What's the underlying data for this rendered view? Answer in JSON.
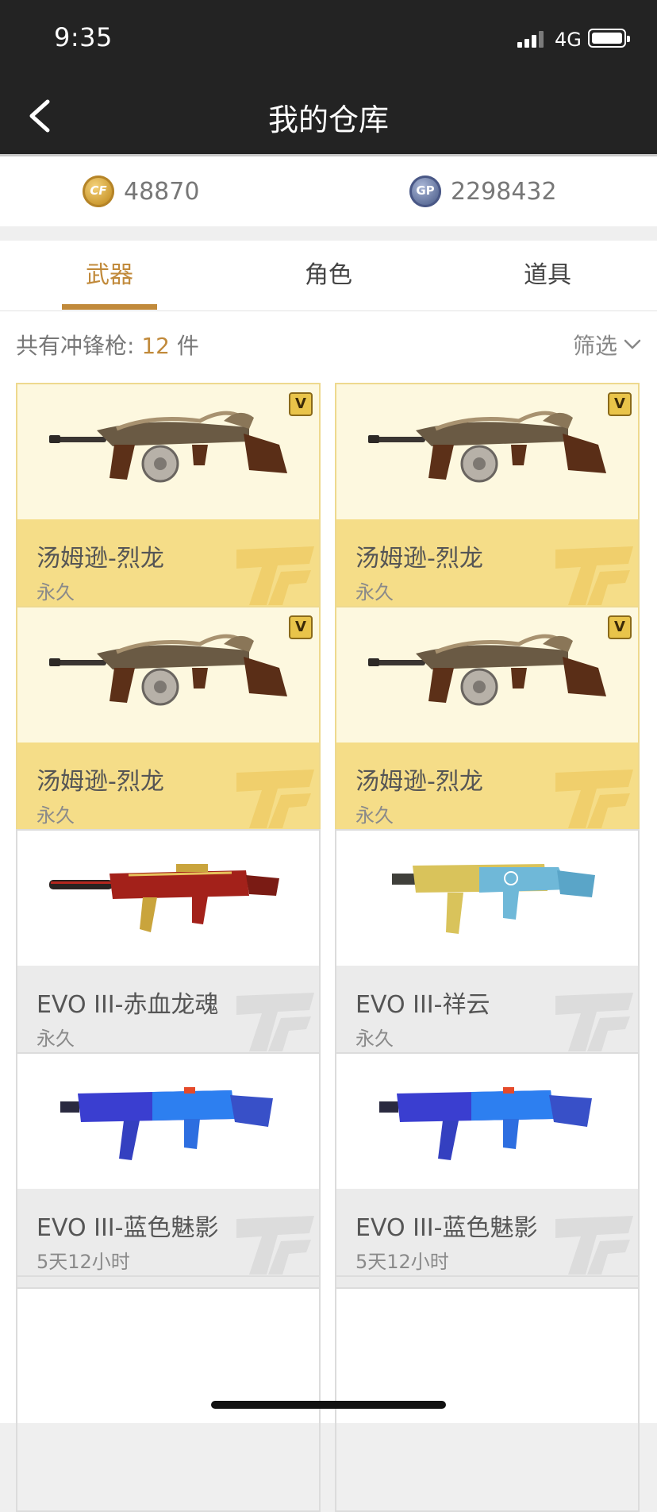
{
  "status": {
    "time": "9:35",
    "network": "4G"
  },
  "nav": {
    "title": "我的仓库"
  },
  "currency": {
    "cf_points": "48870",
    "gp": "2298432"
  },
  "tabs": [
    {
      "label": "武器"
    },
    {
      "label": "角色"
    },
    {
      "label": "道具"
    }
  ],
  "summary": {
    "prefix": "共有冲锋枪: ",
    "count": "12",
    "suffix": " 件",
    "filter_label": "筛选"
  },
  "items": [
    {
      "name": "汤姆逊-烈龙",
      "duration": "永久",
      "style": "gold",
      "weapon": "thompson-dragon"
    },
    {
      "name": "汤姆逊-烈龙",
      "duration": "永久",
      "style": "gold",
      "weapon": "thompson-dragon"
    },
    {
      "name": "汤姆逊-烈龙",
      "duration": "永久",
      "style": "gold",
      "weapon": "thompson-dragon"
    },
    {
      "name": "汤姆逊-烈龙",
      "duration": "永久",
      "style": "gold",
      "weapon": "thompson-dragon"
    },
    {
      "name": "EVO III-赤血龙魂",
      "duration": "永久",
      "style": "gray",
      "weapon": "evo-red"
    },
    {
      "name": "EVO III-祥云",
      "duration": "永久",
      "style": "gray",
      "weapon": "evo-cloud"
    },
    {
      "name": "EVO III-蓝色魅影",
      "duration": "5天12小时",
      "style": "gray",
      "weapon": "evo-blue"
    },
    {
      "name": "EVO III-蓝色魅影",
      "duration": "5天12小时",
      "style": "gray",
      "weapon": "evo-blue"
    }
  ],
  "colors": {
    "accent": "#c18a3b",
    "gold_card": "#f5dd88",
    "gray_card": "#ebebeb",
    "bar": "#232323"
  }
}
